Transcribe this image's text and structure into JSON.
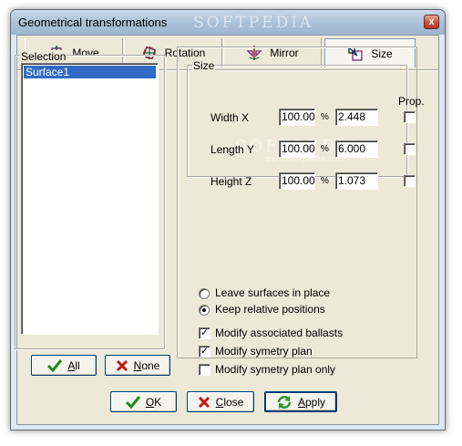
{
  "window": {
    "title": "Geometrical transformations",
    "close_glyph": "x"
  },
  "tabs": [
    {
      "label": "Move",
      "icon": "move-icon",
      "active": false
    },
    {
      "label": "Rotation",
      "icon": "rotation-icon",
      "active": false
    },
    {
      "label": "Mirror",
      "icon": "mirror-icon",
      "active": false
    },
    {
      "label": "Size",
      "icon": "size-icon",
      "active": true
    }
  ],
  "selection": {
    "legend": "Selection",
    "items": [
      "Surface1"
    ],
    "all_button": {
      "underline": "A",
      "rest": "ll"
    },
    "none_button": {
      "underline": "N",
      "rest": "one"
    }
  },
  "size": {
    "legend": "Size",
    "prop_header": "Prop.",
    "rows": [
      {
        "label": "Width X",
        "percent": "100.00",
        "pct_sign": "%",
        "value": "2.448",
        "prop_checked": false
      },
      {
        "label": "Length Y",
        "percent": "100.00",
        "pct_sign": "%",
        "value": "6.000",
        "prop_checked": false
      },
      {
        "label": "Height Z",
        "percent": "100.00",
        "pct_sign": "%",
        "value": "1.073",
        "prop_checked": false
      }
    ]
  },
  "options": {
    "radios": [
      {
        "label": "Leave surfaces in place",
        "selected": false
      },
      {
        "label": "Keep relative positions",
        "selected": true
      }
    ],
    "checkboxes": [
      {
        "label": "Modify associated ballasts",
        "checked": true
      },
      {
        "label": "Modify symetry plan",
        "checked": true
      },
      {
        "label": "Modify symetry plan only",
        "checked": false
      }
    ],
    "check_glyph": "✓"
  },
  "footer": {
    "ok": {
      "underline": "O",
      "rest": "K"
    },
    "close": {
      "underline": "C",
      "rest": "lose"
    },
    "apply": {
      "underline": "A",
      "rest": "pply"
    }
  },
  "watermark": {
    "title_text": "SOFTPEDIA",
    "center_text": "SOFTPEDIA",
    "url_text": "www.softpedia.com"
  },
  "colors": {
    "selection_highlight": "#316ac5",
    "ok_check": "#1f8a1f",
    "close_cross": "#c01818",
    "apply_arrows": "#2a9a2a"
  }
}
